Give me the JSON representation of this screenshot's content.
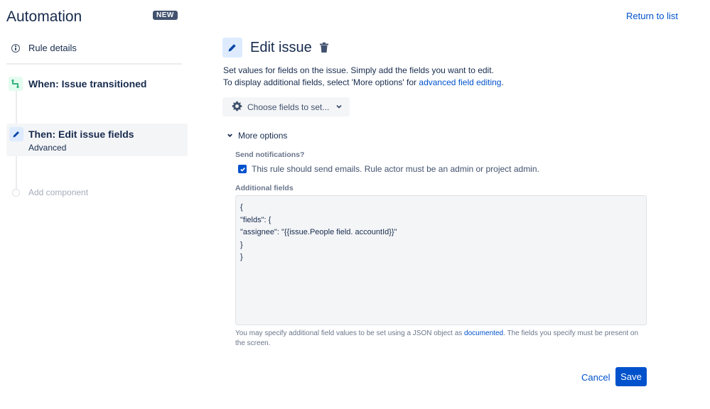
{
  "app": {
    "title": "Automation",
    "badge": "NEW"
  },
  "sidebar": {
    "rule_details": "Rule details",
    "when": {
      "title": "When: Issue transitioned"
    },
    "then": {
      "title": "Then: Edit issue fields",
      "subtitle": "Advanced"
    },
    "add_component": "Add component"
  },
  "header": {
    "return_link": "Return to list"
  },
  "panel": {
    "title": "Edit issue",
    "desc_line1": "Set values for fields on the issue. Simply add the fields you want to edit.",
    "desc_line2_prefix": "To display additional fields, select 'More options' for ",
    "desc_link": "advanced field editing",
    "desc_line2_suffix": ".",
    "choose_fields": "Choose fields to set...",
    "more_options": "More options",
    "send_notifications_label": "Send notifications?",
    "send_emails_text": "This rule should send emails. Rule actor must be an admin or project admin.",
    "send_emails_checked": true,
    "additional_fields_label": "Additional fields",
    "additional_fields_value": "{\n\"fields\": {\n\"assignee\": \"{{issue.People field. accountId}}\"\n}\n}",
    "help_prefix": "You may specify additional field values to be set using a JSON object as ",
    "help_link": "documented",
    "help_suffix": ". The fields you specify must be present on the screen.",
    "cancel": "Cancel",
    "save": "Save"
  },
  "colors": {
    "accent": "#0052cc",
    "when_green": "#36b37e",
    "text": "#172b4d"
  }
}
